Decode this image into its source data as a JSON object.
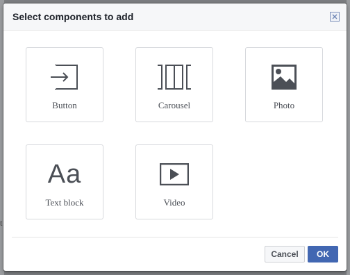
{
  "dialog": {
    "title": "Select components to add",
    "close_icon": "close-icon"
  },
  "components": [
    {
      "label": "Button",
      "icon": "enter-arrow-icon"
    },
    {
      "label": "Carousel",
      "icon": "carousel-icon"
    },
    {
      "label": "Photo",
      "icon": "photo-icon"
    },
    {
      "label": "Text block",
      "icon": "text-block-icon",
      "glyph": "Aa"
    },
    {
      "label": "Video",
      "icon": "video-play-icon"
    }
  ],
  "footer": {
    "cancel_label": "Cancel",
    "ok_label": "OK"
  },
  "backdrop": {
    "partial_text": "t"
  },
  "colors": {
    "accent": "#4267b2",
    "icon": "#4b4f56",
    "tile_border": "#d6d8dc"
  }
}
